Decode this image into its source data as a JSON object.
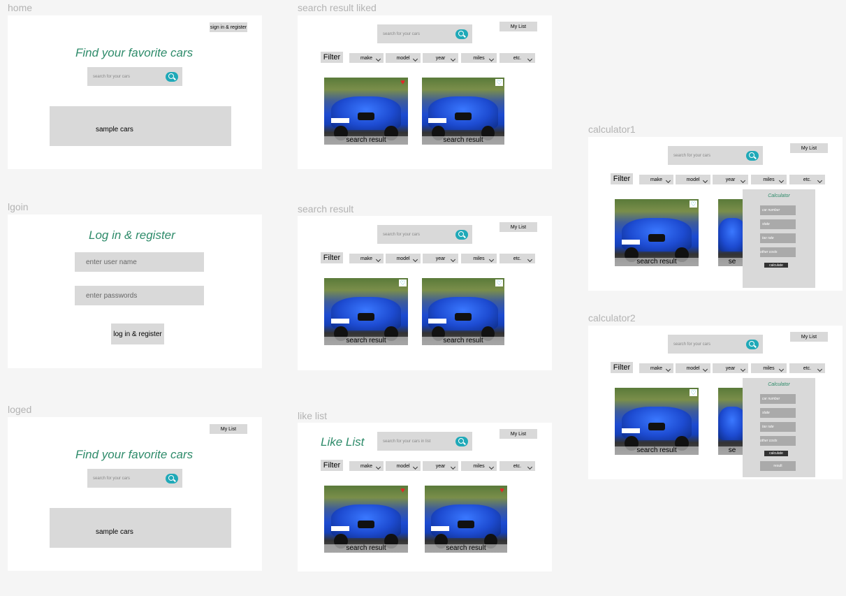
{
  "frames": {
    "home": {
      "label": "home",
      "signin_label": "sign in  & register",
      "headline": "Find your favorite cars",
      "search_placeholder": "search for your cars",
      "sample_label": "sample cars"
    },
    "login": {
      "label": "lgoin",
      "headline": "Log in & register",
      "username_placeholder": "enter user name",
      "password_placeholder": "enter passwords",
      "submit_label": "log in & register"
    },
    "loged": {
      "label": "loged",
      "mylist_label": "My List",
      "headline": "Find your favorite cars",
      "search_placeholder": "search for your cars",
      "sample_label": "sample cars"
    },
    "search_liked": {
      "label": "search result liked",
      "search_placeholder": "search for your cars",
      "mylist_label": "My List",
      "result_label": "search result"
    },
    "search": {
      "label": "search result",
      "search_placeholder": "search for your cars",
      "mylist_label": "My List",
      "result_label": "search result"
    },
    "like_list": {
      "label": "like list",
      "headline": "Like List",
      "search_placeholder": "search for your cars in list",
      "mylist_label": "My List",
      "result_label": "search result"
    },
    "calc1": {
      "label": "calculator1",
      "search_placeholder": "search for your cars",
      "mylist_label": "My List",
      "result_label": "search result"
    },
    "calc2": {
      "label": "calculator2",
      "search_placeholder": "search for your cars",
      "mylist_label": "My List",
      "result_label": "search result"
    }
  },
  "filter": {
    "label": "Filter",
    "dropdowns": [
      "make",
      "model",
      "year",
      "miles",
      "etc."
    ]
  },
  "calculator": {
    "title": "Calculator",
    "fields": [
      "car number",
      "state",
      "tax rate",
      "other costs"
    ],
    "calculate_label": "calculate",
    "result_label": "result"
  },
  "colors": {
    "accent_green": "#2e8b6a",
    "search_button": "#1fa9b8",
    "heart_liked": "#e2262a",
    "panel_gray": "#d9d9d9"
  },
  "icons": {
    "search": "magnifier-icon",
    "liked": "heart-filled-icon",
    "unliked": "heart-outline-icon",
    "dropdown": "chevron-down-icon"
  }
}
